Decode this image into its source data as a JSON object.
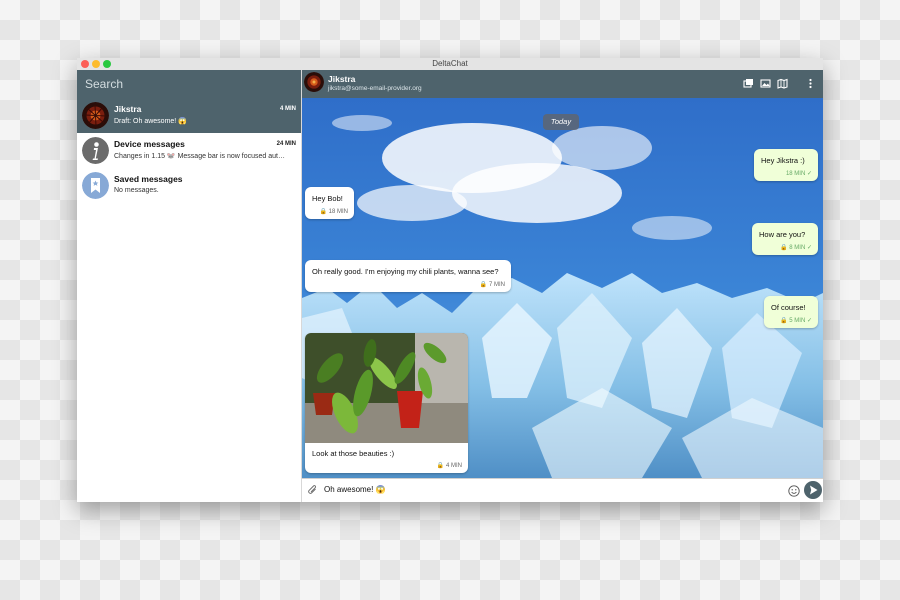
{
  "window": {
    "title": "DeltaChat"
  },
  "sidebar": {
    "search_placeholder": "Search",
    "chats": [
      {
        "name": "Jikstra",
        "preview": "Draft: Oh awesome! 😱",
        "time": "4 MIN",
        "active": true
      },
      {
        "name": "Device messages",
        "preview": "Changes in 1.15 🐭 Message bar is now focused aut…",
        "time": "24 MIN",
        "active": false
      },
      {
        "name": "Saved messages",
        "preview": "No messages.",
        "time": "",
        "active": false
      }
    ]
  },
  "header": {
    "name": "Jikstra",
    "email": "jikstra@some-email-provider.org"
  },
  "header_icons": [
    "gallery-icon",
    "media-icon",
    "map-icon",
    "more-menu-icon"
  ],
  "conversation": {
    "day_label": "Today",
    "messages": [
      {
        "direction": "out",
        "text": "Hey Jikstra :)",
        "time": "18 MIN",
        "status": "✓"
      },
      {
        "direction": "in",
        "text": "Hey Bob!",
        "time": "🔒 18 MIN"
      },
      {
        "direction": "out",
        "text": "How are you?",
        "time": "🔒 8 MIN",
        "status": "✓"
      },
      {
        "direction": "in",
        "text": "Oh really good. I'm enjoying my chili plants, wanna see?",
        "time": "🔒 7 MIN"
      },
      {
        "direction": "out",
        "text": "Of course!",
        "time": "🔒 5 MIN",
        "status": "✓"
      },
      {
        "direction": "in",
        "text": "Look at those beauties :)",
        "time": "🔒 4 MIN",
        "has_image": true
      }
    ]
  },
  "composer": {
    "value": "Oh awesome! 😱"
  },
  "colors": {
    "accent": "#4e636c",
    "outgoing_bubble": "#f0ffd8",
    "sent_check": "#66aa66"
  }
}
